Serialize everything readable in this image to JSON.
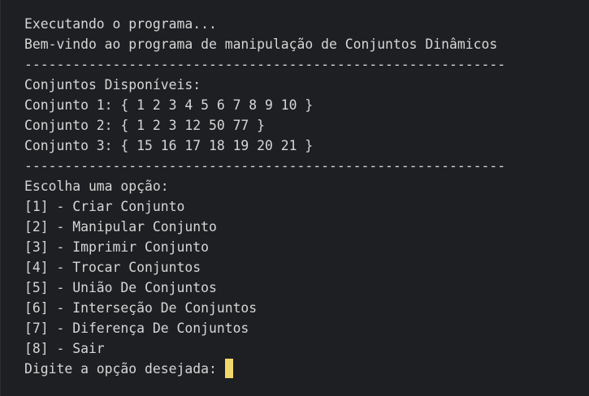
{
  "terminal": {
    "running": "Executando o programa...",
    "welcome": "Bem-vindo ao programa de manipulação de Conjuntos Dinâmicos",
    "separator": "------------------------------------------------------------",
    "sets_header": "Conjuntos Disponíveis:",
    "sets": [
      "Conjunto 1: { 1 2 3 4 5 6 7 8 9 10 }",
      "Conjunto 2: { 1 2 3 12 50 77 }",
      "Conjunto 3: { 15 16 17 18 19 20 21 }"
    ],
    "menu_header": "Escolha uma opção:",
    "options": [
      "[1] - Criar Conjunto",
      "[2] - Manipular Conjunto",
      "[3] - Imprimir Conjunto",
      "[4] - Trocar Conjuntos",
      "[5] - União De Conjuntos",
      "[6] - Interseção De Conjuntos",
      "[7] - Diferença De Conjuntos",
      "[8] - Sair"
    ],
    "prompt": "Digite a opção desejada:",
    "input_value": "",
    "cursor_color": "#f1d86b",
    "text_color": "#d6d6d6",
    "background_color": "#1e1f22"
  }
}
